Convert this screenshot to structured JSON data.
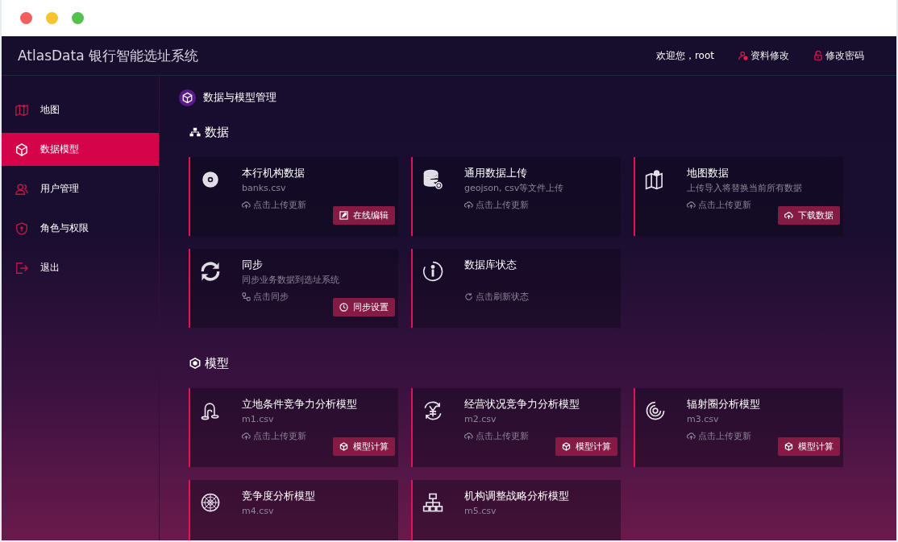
{
  "window": {
    "controls": [
      {
        "color": "#f25f5c"
      },
      {
        "color": "#f7c52b"
      },
      {
        "color": "#53c14b"
      }
    ]
  },
  "header": {
    "title": "AtlasData 银行智能选址系统",
    "welcome": "欢迎您，root",
    "links": [
      {
        "kind": "profile",
        "label": "资料修改"
      },
      {
        "kind": "password",
        "label": "修改密码"
      }
    ]
  },
  "sidebar": {
    "items": [
      {
        "kind": "map",
        "label": "地图",
        "selected": false
      },
      {
        "kind": "model",
        "label": "数据模型",
        "selected": true
      },
      {
        "kind": "users",
        "label": "用户管理",
        "selected": false
      },
      {
        "kind": "roles",
        "label": "角色与权限",
        "selected": false
      },
      {
        "kind": "logout",
        "label": "退出",
        "selected": false
      }
    ]
  },
  "page_title": "数据与模型管理",
  "sections": [
    {
      "kind": "data",
      "title": "数据",
      "cards": [
        {
          "kind": "banks",
          "title": "本行机构数据",
          "subtitle": "banks.csv",
          "action": {
            "kind": "upload",
            "label": "点击上传更新"
          },
          "button": {
            "kind": "edit",
            "label": "在线编辑"
          }
        },
        {
          "kind": "general",
          "title": "通用数据上传",
          "subtitle": "geojson, csv等文件上传",
          "action": {
            "kind": "upload",
            "label": "点击上传更新"
          }
        },
        {
          "kind": "map",
          "title": "地图数据",
          "subtitle": "上传导入将替换当前所有数据",
          "action": {
            "kind": "upload",
            "label": "点击上传更新"
          },
          "button": {
            "kind": "download",
            "label": "下载数据"
          }
        },
        {
          "kind": "sync",
          "title": "同步",
          "subtitle": "同步业务数据到选址系统",
          "action": {
            "kind": "sync",
            "label": "点击同步"
          },
          "button": {
            "kind": "schedule",
            "label": "同步设置"
          }
        },
        {
          "kind": "status",
          "title": "数据库状态",
          "action": {
            "kind": "refresh",
            "label": "点击刷新状态"
          }
        }
      ]
    },
    {
      "kind": "model",
      "title": "模型",
      "cards": [
        {
          "kind": "site",
          "title": "立地条件竞争力分析模型",
          "subtitle": "m1.csv",
          "action": {
            "kind": "upload",
            "label": "点击上传更新"
          },
          "button": {
            "kind": "compute",
            "label": "模型计算"
          }
        },
        {
          "kind": "business",
          "title": "经营状况竞争力分析模型",
          "subtitle": "m2.csv",
          "action": {
            "kind": "upload",
            "label": "点击上传更新"
          },
          "button": {
            "kind": "compute",
            "label": "模型计算"
          }
        },
        {
          "kind": "radius",
          "title": "辐射圈分析模型",
          "subtitle": "m3.csv",
          "action": {
            "kind": "upload",
            "label": "点击上传更新"
          },
          "button": {
            "kind": "compute",
            "label": "模型计算"
          }
        },
        {
          "kind": "competition",
          "title": "竞争度分析模型",
          "subtitle": "m4.csv"
        },
        {
          "kind": "strategy",
          "title": "机构调整战略分析模型",
          "subtitle": "m5.csv"
        }
      ]
    }
  ]
}
